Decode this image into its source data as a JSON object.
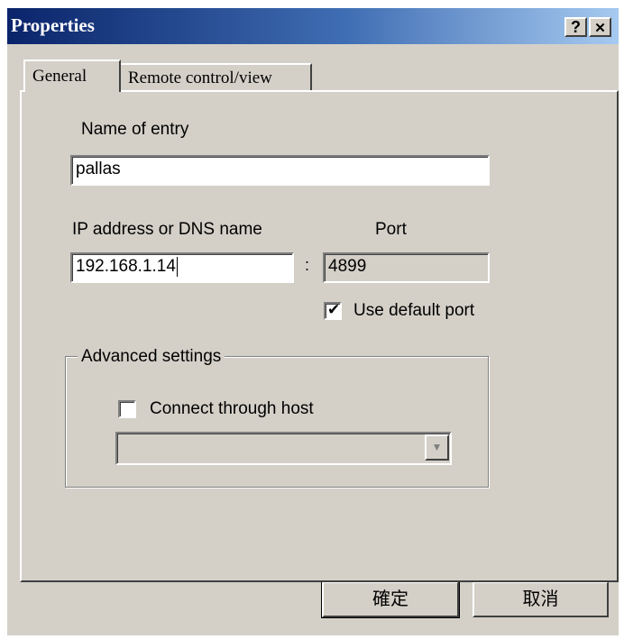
{
  "window": {
    "title": "Properties",
    "help_label": "?",
    "close_label": "✕"
  },
  "tabs": [
    {
      "label": "General",
      "active": true
    },
    {
      "label": "Remote control/view",
      "active": false
    }
  ],
  "form": {
    "name_label": "Name of entry",
    "name_value": "pallas",
    "ip_label": "IP address or DNS name",
    "ip_value": "192.168.1.14",
    "separator": ":",
    "port_label": "Port",
    "port_value": "4899",
    "use_default_port_label": "Use default port",
    "use_default_port_checked": true,
    "checkmark": "✔"
  },
  "advanced": {
    "legend": "Advanced settings",
    "connect_through_host_label": "Connect through host",
    "connect_through_host_checked": false,
    "host_value": "",
    "dropdown_arrow": "▼"
  },
  "buttons": {
    "ok_label": "確定",
    "cancel_label": "取消"
  },
  "colors": {
    "dialog_face": "#d4d0c8",
    "titlebar_start": "#0a246a",
    "titlebar_end": "#a6caf0",
    "field_bg": "#ffffff"
  }
}
